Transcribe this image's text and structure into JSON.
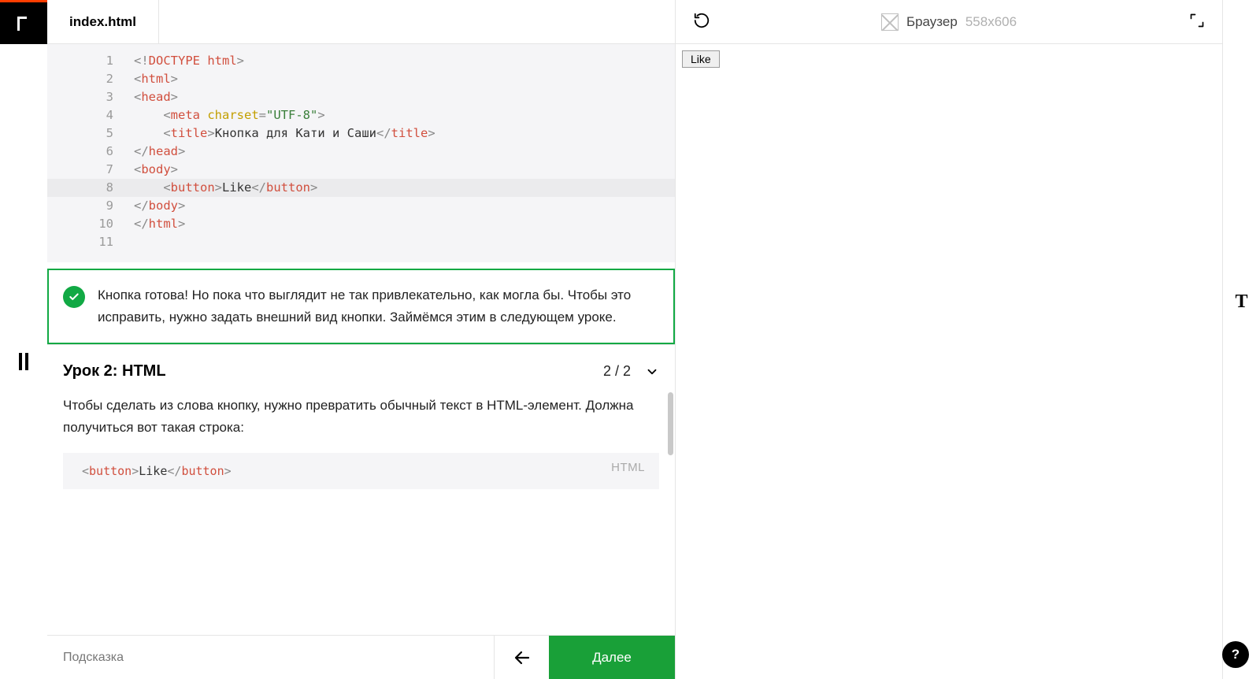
{
  "tab": {
    "filename": "index.html"
  },
  "editor": {
    "lines": [
      {
        "n": 1,
        "tokens": [
          [
            "punct",
            "<!"
          ],
          [
            "tag",
            "DOCTYPE html"
          ],
          [
            "punct",
            ">"
          ]
        ]
      },
      {
        "n": 2,
        "tokens": [
          [
            "punct",
            "<"
          ],
          [
            "tag",
            "html"
          ],
          [
            "punct",
            ">"
          ]
        ]
      },
      {
        "n": 3,
        "tokens": [
          [
            "punct",
            "<"
          ],
          [
            "tag",
            "head"
          ],
          [
            "punct",
            ">"
          ]
        ]
      },
      {
        "n": 4,
        "indent": 2,
        "tokens": [
          [
            "punct",
            "<"
          ],
          [
            "tag",
            "meta "
          ],
          [
            "attr",
            "charset"
          ],
          [
            "punct",
            "="
          ],
          [
            "str",
            "\"UTF-8\""
          ],
          [
            "punct",
            ">"
          ]
        ]
      },
      {
        "n": 5,
        "indent": 2,
        "tokens": [
          [
            "punct",
            "<"
          ],
          [
            "tag",
            "title"
          ],
          [
            "punct",
            ">"
          ],
          [
            "text",
            "Кнопка для Кати и Саши"
          ],
          [
            "punct",
            "</"
          ],
          [
            "tag",
            "title"
          ],
          [
            "punct",
            ">"
          ]
        ]
      },
      {
        "n": 6,
        "tokens": [
          [
            "punct",
            "</"
          ],
          [
            "tag",
            "head"
          ],
          [
            "punct",
            ">"
          ]
        ]
      },
      {
        "n": 7,
        "tokens": [
          [
            "punct",
            "<"
          ],
          [
            "tag",
            "body"
          ],
          [
            "punct",
            ">"
          ]
        ]
      },
      {
        "n": 8,
        "indent": 2,
        "current": true,
        "tokens": [
          [
            "punct",
            "<"
          ],
          [
            "tag",
            "button"
          ],
          [
            "punct",
            ">"
          ],
          [
            "text",
            "Like"
          ],
          [
            "punct",
            "</"
          ],
          [
            "tag",
            "button"
          ],
          [
            "punct",
            ">"
          ]
        ]
      },
      {
        "n": 9,
        "tokens": [
          [
            "punct",
            "</"
          ],
          [
            "tag",
            "body"
          ],
          [
            "punct",
            ">"
          ]
        ]
      },
      {
        "n": 10,
        "tokens": [
          [
            "punct",
            "</"
          ],
          [
            "tag",
            "html"
          ],
          [
            "punct",
            ">"
          ]
        ]
      },
      {
        "n": 11,
        "tokens": []
      }
    ]
  },
  "success": {
    "text": "Кнопка готова! Но пока что выглядит не так привлекательно, как могла бы. Чтобы это исправить, нужно задать внешний вид кнопки. Займёмся этим в следующем уроке."
  },
  "lesson": {
    "title": "Урок 2: HTML",
    "progress": "2 / 2",
    "body": "Чтобы сделать из слова кнопку, нужно превратить обычный текст в HTML-элемент. Должна получиться вот такая строка:",
    "snippet_lang": "HTML",
    "snippet_tokens": [
      [
        "punct",
        "<"
      ],
      [
        "tag",
        "button"
      ],
      [
        "punct",
        ">"
      ],
      [
        "text",
        "Like"
      ],
      [
        "punct",
        "</"
      ],
      [
        "tag",
        "button"
      ],
      [
        "punct",
        ">"
      ]
    ]
  },
  "bottom": {
    "hint": "Подсказка",
    "next": "Далее"
  },
  "preview": {
    "label": "Браузер",
    "dims": "558x606",
    "button_label": "Like"
  },
  "right": {
    "tool": "T",
    "help": "?"
  }
}
